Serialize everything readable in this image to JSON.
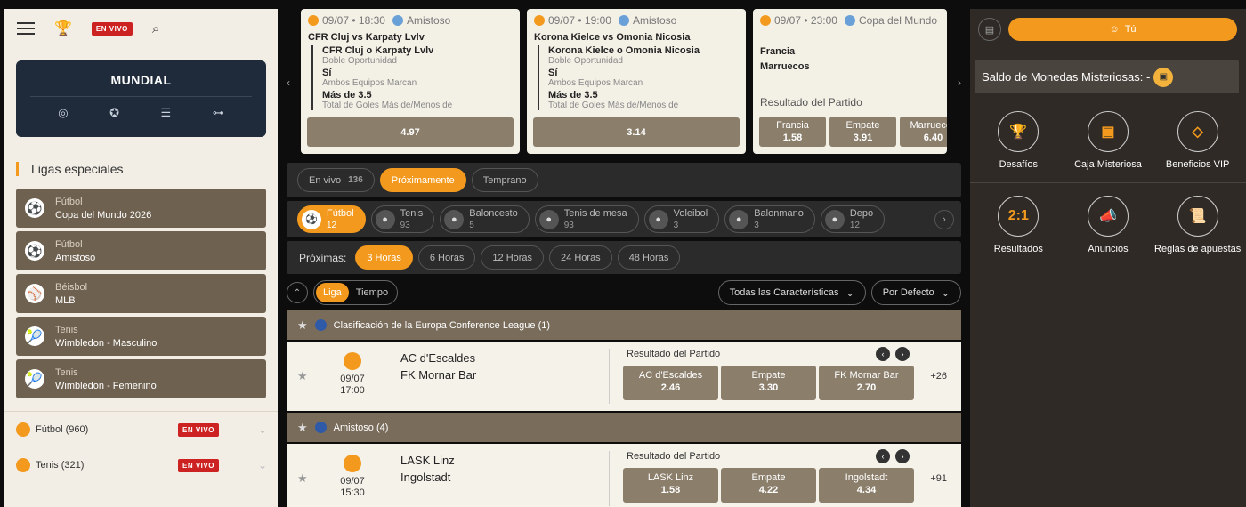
{
  "header": {
    "live_badge": "EN VIVO"
  },
  "mundial": {
    "title": "MUNDIAL"
  },
  "ligas": {
    "title": "Ligas especiales",
    "items": [
      {
        "sport": "Fútbol",
        "name": "Copa del Mundo 2026"
      },
      {
        "sport": "Fútbol",
        "name": "Amistoso"
      },
      {
        "sport": "Béisbol",
        "name": "MLB"
      },
      {
        "sport": "Tenis",
        "name": "Wimbledon - Masculino"
      },
      {
        "sport": "Tenis",
        "name": "Wimbledon - Femenino"
      }
    ]
  },
  "sports_list": [
    {
      "name": "Fútbol",
      "count": "(960)",
      "badge": "EN VIVO"
    },
    {
      "name": "Tenis",
      "count": "(321)",
      "badge": "EN VIVO"
    }
  ],
  "cards": [
    {
      "date": "09/07 • 18:30",
      "comp": "Amistoso",
      "teams": "CFR Cluj vs Karpaty Lvlv",
      "selections": [
        {
          "line": "CFR Cluj o Karpaty Lvlv",
          "market": "Doble Oportunidad"
        },
        {
          "line": "Sí",
          "market": "Ambos Equipos Marcan"
        },
        {
          "line": "Más de 3.5",
          "market": "Total de Goles Más de/Menos de"
        }
      ],
      "odds": "4.97"
    },
    {
      "date": "09/07 • 19:00",
      "comp": "Amistoso",
      "teams": "Korona Kielce vs Omonia Nicosia",
      "selections": [
        {
          "line": "Korona Kielce o Omonia Nicosia",
          "market": "Doble Oportunidad"
        },
        {
          "line": "Sí",
          "market": "Ambos Equipos Marcan"
        },
        {
          "line": "Más de 3.5",
          "market": "Total de Goles Más de/Menos de"
        }
      ],
      "odds": "3.14"
    },
    {
      "date": "09/07 • 23:00",
      "comp": "Copa del Mundo",
      "team1": "Francia",
      "team2": "Marruecos",
      "market": "Resultado del Partido",
      "outcomes": [
        {
          "label": "Francia",
          "odds": "1.58"
        },
        {
          "label": "Empate",
          "odds": "3.91"
        },
        {
          "label": "Marruecos",
          "odds": "6.40"
        }
      ]
    }
  ],
  "tabs": [
    {
      "label": "En vivo",
      "count": "136"
    },
    {
      "label": "Próximamente",
      "count": ""
    },
    {
      "label": "Temprano",
      "count": ""
    }
  ],
  "sports": [
    {
      "label": "Fútbol",
      "count": "12",
      "icon": "⚽"
    },
    {
      "label": "Tenis",
      "count": "93",
      "icon": "🎾"
    },
    {
      "label": "Baloncesto",
      "count": "5",
      "icon": "🏀"
    },
    {
      "label": "Tenis de mesa",
      "count": "93",
      "icon": "🏓"
    },
    {
      "label": "Voleibol",
      "count": "3",
      "icon": "🏐"
    },
    {
      "label": "Balonmano",
      "count": "3",
      "icon": "🤾"
    },
    {
      "label": "Depo",
      "count": "12",
      "icon": "🎮"
    }
  ],
  "proximas": {
    "label": "Próximas:",
    "options": [
      "3 Horas",
      "6 Horas",
      "12 Horas",
      "24 Horas",
      "48 Horas"
    ]
  },
  "view": {
    "liga": "Liga",
    "tiempo": "Tiempo",
    "features": "Todas las Características",
    "sort": "Por Defecto"
  },
  "leagues": [
    {
      "name": "Clasificación de la Europa Conference League (1)",
      "event": {
        "date": "09/07",
        "time": "17:00",
        "home": "AC d'Escaldes",
        "away": "FK Mornar Bar",
        "market": "Resultado del Partido",
        "outcomes": [
          {
            "label": "AC d'Escaldes",
            "odds": "2.46"
          },
          {
            "label": "Empate",
            "odds": "3.30"
          },
          {
            "label": "FK Mornar Bar",
            "odds": "2.70"
          }
        ],
        "more": "+26"
      }
    },
    {
      "name": "Amistoso (4)",
      "event": {
        "date": "09/07",
        "time": "15:30",
        "home": "LASK Linz",
        "away": "Ingolstadt",
        "market": "Resultado del Partido",
        "outcomes": [
          {
            "label": "LASK Linz",
            "odds": "1.58"
          },
          {
            "label": "Empate",
            "odds": "4.22"
          },
          {
            "label": "Ingolstadt",
            "odds": "4.34"
          }
        ],
        "more": "+91"
      }
    }
  ],
  "right_panel": {
    "user_label": "Tú",
    "saldo": "Saldo de Monedas Misteriosas: -",
    "row1": [
      {
        "label": "Desafíos",
        "icon": "🏆"
      },
      {
        "label": "Caja Misteriosa",
        "icon": "▣"
      },
      {
        "label": "Beneficios VIP",
        "icon": "◇"
      }
    ],
    "row2": [
      {
        "label": "Resultados",
        "icon": "2:1"
      },
      {
        "label": "Anuncios",
        "icon": "📣"
      },
      {
        "label": "Reglas de apuestas",
        "icon": "📜"
      }
    ]
  }
}
